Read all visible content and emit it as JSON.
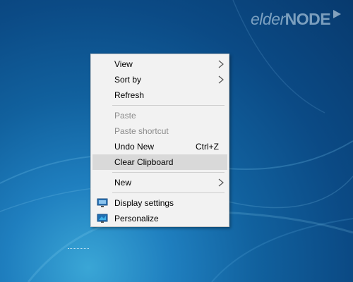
{
  "watermark": {
    "brand_part1": "elder",
    "brand_part2": "NODE"
  },
  "context_menu": {
    "items": [
      {
        "label": "View",
        "has_submenu": true
      },
      {
        "label": "Sort by",
        "has_submenu": true
      },
      {
        "label": "Refresh"
      },
      {
        "label": "Paste",
        "disabled": true
      },
      {
        "label": "Paste shortcut",
        "disabled": true
      },
      {
        "label": "Undo New",
        "shortcut": "Ctrl+Z"
      },
      {
        "label": "Clear Clipboard",
        "highlighted": true
      },
      {
        "label": "New",
        "has_submenu": true
      },
      {
        "label": "Display settings",
        "icon": "display-settings-icon"
      },
      {
        "label": "Personalize",
        "icon": "personalize-icon"
      }
    ]
  },
  "colors": {
    "menu_background": "#f2f2f2",
    "highlight": "#d9d9d9",
    "disabled_text": "#8c8c8c",
    "desktop_blue": "#0b4a85"
  }
}
